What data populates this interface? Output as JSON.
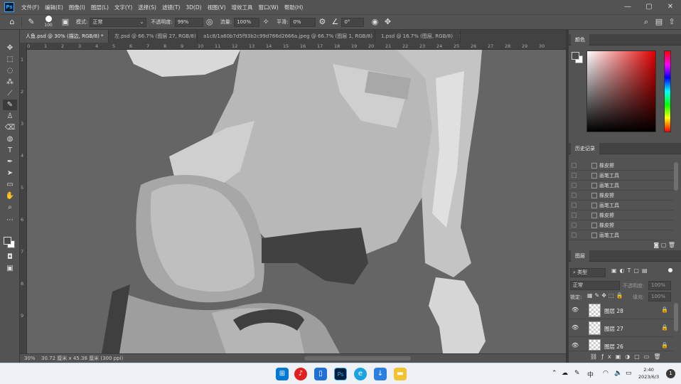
{
  "menubar": {
    "logo": "Ps",
    "items": [
      "文件(F)",
      "编辑(E)",
      "图像(I)",
      "图层(L)",
      "文字(Y)",
      "选择(S)",
      "滤镜(T)",
      "3D(D)",
      "视图(V)",
      "增效工具",
      "窗口(W)",
      "帮助(H)"
    ],
    "window_controls": [
      "—",
      "▢",
      "✕"
    ]
  },
  "options": {
    "brush_size": "100",
    "mode_label": "模式:",
    "mode_value": "正常",
    "opacity_label": "不透明度:",
    "opacity_value": "99%",
    "flow_label": "流量:",
    "flow_value": "100%",
    "smooth_label": "平滑:",
    "smooth_value": "0%",
    "angle_value": "0°"
  },
  "tabs": [
    {
      "label": "人鱼.psd @ 30% (描边, RGB/8) *",
      "active": true
    },
    {
      "label": "左.psd @ 66.7% (图层 27, RGB/8)",
      "active": false
    },
    {
      "label": "a1c8/1a60b7d5f93b2c99d786d2666a.jpeg @ 66.7% (图层 1, RGB/8)",
      "active": false
    },
    {
      "label": "1.psd @ 16.7% (图层, RGB/8)",
      "active": false
    }
  ],
  "ruler": {
    "top": [
      "0",
      "1",
      "2",
      "3",
      "4",
      "5",
      "6",
      "7",
      "8",
      "9",
      "10",
      "11",
      "12",
      "13",
      "14",
      "15",
      "16",
      "17",
      "18",
      "19",
      "20",
      "21",
      "22",
      "23",
      "24",
      "25",
      "26",
      "27",
      "28",
      "29",
      "30"
    ],
    "left": [
      "1",
      "2",
      "3",
      "4",
      "5",
      "6",
      "7",
      "8",
      "9"
    ]
  },
  "status": {
    "zoom": "30%",
    "dimensions": "30.72 厘米 x 45.38 厘米 (300 ppi)"
  },
  "color_panel": {
    "title": "颜色",
    "picker_hue": "#e00000"
  },
  "history_panel": {
    "title": "历史记录",
    "items": [
      "橡皮擦",
      "画笔工具",
      "画笔工具",
      "橡皮擦",
      "画笔工具",
      "橡皮擦",
      "橡皮擦",
      "画笔工具"
    ]
  },
  "layers_panel": {
    "title": "图层",
    "filter_kind": "类型",
    "blend_mode": "正常",
    "opacity_label": "不透明度:",
    "opacity_value": "100%",
    "lock_label": "锁定:",
    "fill_label": "填充:",
    "fill_value": "100%",
    "layers": [
      "图层 28",
      "图层 27",
      "图层 26"
    ]
  },
  "taskbar": {
    "ime": "中",
    "time": "2:40",
    "date": "2023/6/3",
    "notifications": "1"
  }
}
